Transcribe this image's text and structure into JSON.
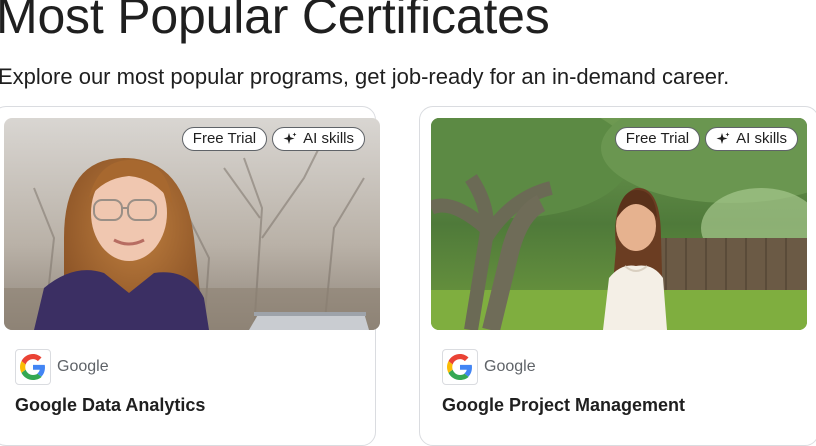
{
  "section": {
    "title": "Most Popular Certificates",
    "subtitle": "Explore our most popular programs, get job-ready for an in-demand career."
  },
  "cards": [
    {
      "badges": [
        "Free Trial",
        "AI skills"
      ],
      "partner": "Google",
      "title": "Google Data Analytics"
    },
    {
      "badges": [
        "Free Trial",
        "AI skills"
      ],
      "partner": "Google",
      "title": "Google Project Management"
    }
  ],
  "icons": {
    "sparkle": "sparkle-icon",
    "logo": "google-logo-icon"
  },
  "colors": {
    "google_blue": "#4285F4",
    "google_red": "#EA4335",
    "google_yellow": "#FBBC05",
    "google_green": "#34A853"
  }
}
